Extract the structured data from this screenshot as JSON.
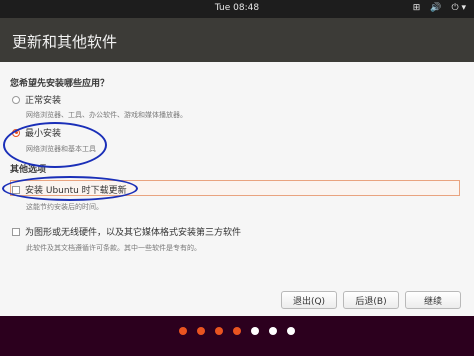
{
  "topbar": {
    "clock": "Tue 08:48",
    "icons": [
      "network-icon",
      "volume-icon",
      "power-icon"
    ],
    "tray_glyphs": [
      "⊞",
      "🔊",
      "⏻ ▾"
    ]
  },
  "window": {
    "title": "更新和其他软件",
    "question": "您希望先安装哪些应用？",
    "options": [
      {
        "label": "正常安装",
        "desc": "网络浏览器、工具、办公软件、游戏和媒体播放器。",
        "selected": false
      },
      {
        "label": "最小安装",
        "desc": "网络浏览器和基本工具",
        "selected": true
      }
    ],
    "other_title": "其他选项",
    "other_options": [
      {
        "label": "安装 Ubuntu 时下载更新",
        "desc": "这能节约安装后的时间。",
        "checked": false
      },
      {
        "label": "为图形或无线硬件，以及其它媒体格式安装第三方软件",
        "desc": "此软件及其文档遵循许可条款。其中一些软件是专有的。",
        "checked": false
      }
    ],
    "buttons": {
      "quit": "退出(Q)",
      "back": "后退(B)",
      "continue": "继续"
    }
  },
  "progress": {
    "dots_total": 7,
    "dots_active": 4,
    "colors": {
      "active": "#e95420",
      "inactive": "#ffffff"
    }
  }
}
